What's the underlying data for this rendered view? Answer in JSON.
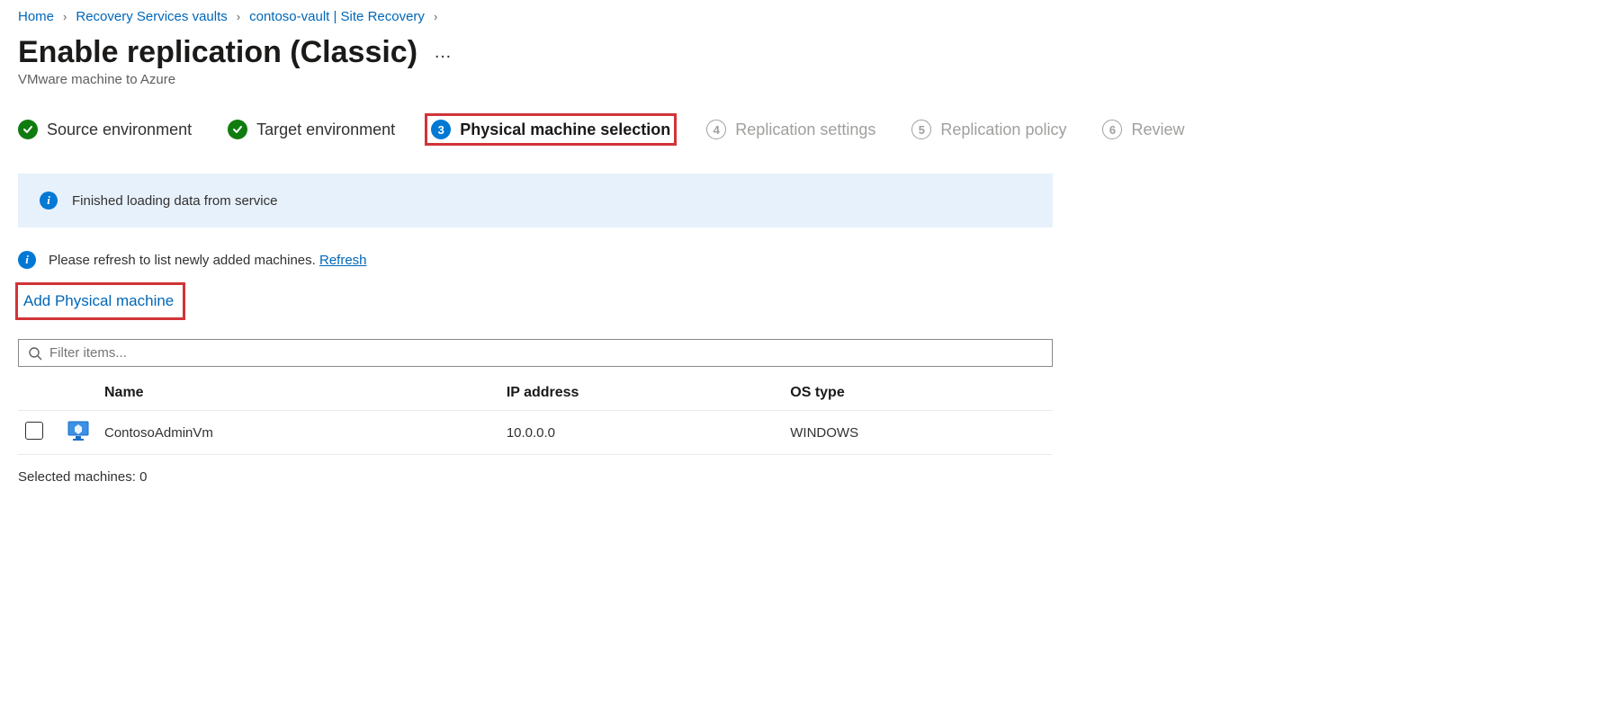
{
  "breadcrumb": [
    {
      "label": "Home"
    },
    {
      "label": "Recovery Services vaults"
    },
    {
      "label": "contoso-vault | Site Recovery"
    }
  ],
  "page": {
    "title": "Enable replication (Classic)",
    "subtitle": "VMware machine to Azure",
    "more": "…"
  },
  "steps": [
    {
      "num": "1",
      "label": "Source environment",
      "state": "done"
    },
    {
      "num": "2",
      "label": "Target environment",
      "state": "done"
    },
    {
      "num": "3",
      "label": "Physical machine selection",
      "state": "current",
      "highlight": true
    },
    {
      "num": "4",
      "label": "Replication settings",
      "state": "future"
    },
    {
      "num": "5",
      "label": "Replication policy",
      "state": "future"
    },
    {
      "num": "6",
      "label": "Review",
      "state": "future"
    }
  ],
  "banner": {
    "text": "Finished loading data from service"
  },
  "hint": {
    "text": "Please refresh to list newly added machines. ",
    "refresh": "Refresh"
  },
  "add_link": "Add Physical machine",
  "filter": {
    "placeholder": "Filter items..."
  },
  "table": {
    "headers": {
      "name": "Name",
      "ip": "IP address",
      "os": "OS type"
    },
    "rows": [
      {
        "name": "ContosoAdminVm",
        "ip": "10.0.0.0",
        "os": "WINDOWS"
      }
    ]
  },
  "selected": {
    "label": "Selected machines: ",
    "count": "0"
  }
}
